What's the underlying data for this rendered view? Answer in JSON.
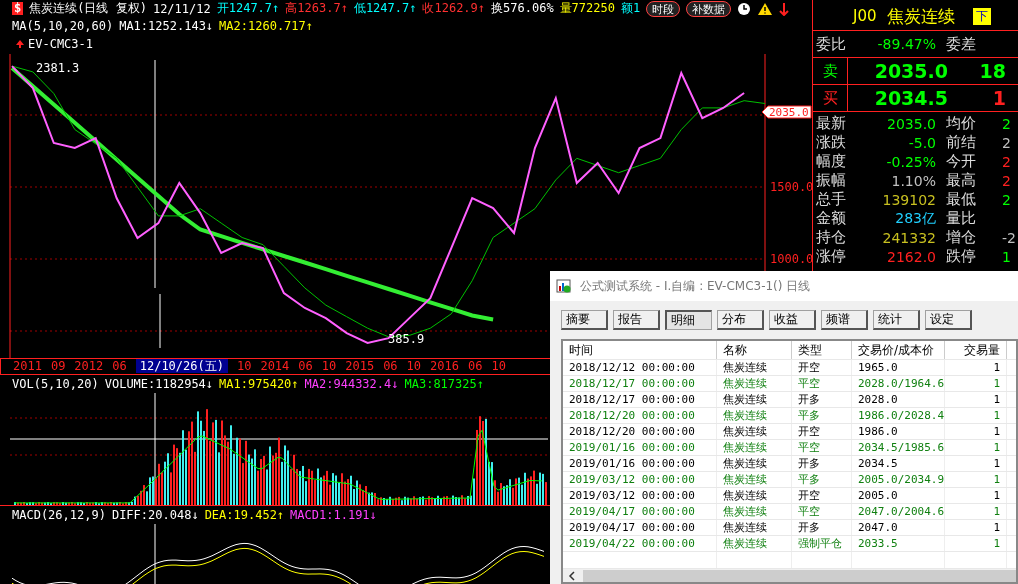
{
  "quote_header": {
    "symbol": "$",
    "items": [
      {
        "text": "焦炭连续(日线 复权)",
        "color": "#ffffff"
      },
      {
        "text": "12/11/12",
        "color": "#ffffff"
      },
      {
        "text": "开1247.7↑",
        "color": "#00ffff"
      },
      {
        "text": "高1263.7↑",
        "color": "#ff3030"
      },
      {
        "text": "低1247.7↑",
        "color": "#00ffff"
      },
      {
        "text": "收1262.9↑",
        "color": "#ff3030"
      },
      {
        "text": "换576.06%",
        "color": "#ffffff"
      },
      {
        "text": "量772250",
        "color": "#ffff00"
      },
      {
        "text": "额1",
        "color": "#00ffff"
      }
    ],
    "buttons": [
      "时段",
      "补数据"
    ]
  },
  "ma_line": {
    "label": "MA(5,10,20,60)",
    "items": [
      {
        "text": "MA1:1252.143↓",
        "color": "#ffffff"
      },
      {
        "text": "MA2:1260.717↑",
        "color": "#ffff00"
      }
    ]
  },
  "price_chart": {
    "high_label": "2381.3",
    "low_label": "385.9",
    "last_price": "2035.0",
    "chart_data": {
      "type": "line",
      "ylim": [
        313,
        2424
      ],
      "yticks": [
        {
          "value": 1000,
          "label": "1000.0"
        },
        {
          "value": 1500,
          "label": "1500.0"
        }
      ],
      "series": [
        {
          "color": "#ff60ff",
          "values": [
            2340,
            2187,
            1806,
            1771,
            1840,
            1424,
            1146,
            1250,
            1528,
            1319,
            1042,
            1111,
            1076,
            764,
            660,
            590,
            486,
            417,
            451,
            590,
            729,
            1076,
            1424,
            1354,
            1181,
            1771,
            2118,
            1528,
            1667,
            1458,
            1771,
            1840,
            2292,
            1979,
            2049,
            2153,
            null
          ]
        },
        {
          "color": "#00c000",
          "values": [
            2340,
            2300,
            2150,
            1900,
            1800,
            1700,
            1500,
            1300,
            1300,
            1350,
            1250,
            1150,
            1100,
            950,
            800,
            680,
            600,
            520,
            460,
            470,
            520,
            620,
            850,
            1150,
            1250,
            1350,
            1550,
            1700,
            1650,
            1600,
            1650,
            1700,
            1900,
            2050,
            2050,
            2100,
            2080
          ]
        },
        {
          "name": "EV-CMC3-1",
          "color": "#33ee33",
          "values": [
            2327,
            2200,
            2073,
            1946,
            1819,
            1692,
            1565,
            1438,
            1311,
            1205,
            1159,
            1113,
            1067,
            1021,
            976,
            930,
            884,
            838,
            792,
            746,
            700,
            654,
            608,
            580,
            null,
            null,
            null,
            null,
            null,
            null,
            null,
            null,
            null,
            null,
            null,
            null,
            null
          ]
        }
      ]
    }
  },
  "date_axis": [
    {
      "label": "2011",
      "selected": false
    },
    {
      "label": "09",
      "selected": false
    },
    {
      "label": "2012",
      "selected": false
    },
    {
      "label": "06",
      "selected": false
    },
    {
      "label": "12/10/26(五)",
      "selected": true
    },
    {
      "label": "10",
      "selected": false
    },
    {
      "label": "2014",
      "selected": false
    },
    {
      "label": "06",
      "selected": false
    },
    {
      "label": "10",
      "selected": false
    },
    {
      "label": "2015",
      "selected": false
    },
    {
      "label": "06",
      "selected": false
    },
    {
      "label": "10",
      "selected": false
    },
    {
      "label": "2016",
      "selected": false
    },
    {
      "label": "06",
      "selected": false
    },
    {
      "label": "10",
      "selected": false
    }
  ],
  "volume_panel": {
    "label": "VOL(5,10,20)",
    "items": [
      {
        "text": "VOLUME:1182954↓",
        "color": "#ffffff"
      },
      {
        "text": "MA1:975420↑",
        "color": "#ffff00"
      },
      {
        "text": "MA2:944332.4↓",
        "color": "#ff40ff"
      },
      {
        "text": "MA3:817325↑",
        "color": "#00ff00"
      }
    ]
  },
  "macd_panel": {
    "label": "MACD(26,12,9)",
    "items": [
      {
        "text": "DIFF:20.048↓",
        "color": "#ffffff"
      },
      {
        "text": "DEA:19.452↑",
        "color": "#ffff00"
      },
      {
        "text": "MACD1:1.191↓",
        "color": "#ff40ff"
      }
    ]
  },
  "quote_panel": {
    "code": "J00",
    "name": "焦炭连续",
    "badge": "下",
    "ratio": {
      "label": "委比",
      "value": "-89.47%",
      "color": "#00ff00",
      "label2": "委差"
    },
    "book": [
      {
        "kind": "sell",
        "label": "卖",
        "price": "2035.0",
        "volume": "18",
        "color": "#00ff00"
      },
      {
        "kind": "buy",
        "label": "买",
        "price": "2034.5",
        "volume": "1",
        "color": "#ff2020"
      }
    ],
    "rows": [
      {
        "left": {
          "label": "最新",
          "value": "2035.0",
          "color": "#00ff00"
        },
        "right": {
          "label": "均价",
          "value": "2",
          "color": "#00ff00"
        }
      },
      {
        "left": {
          "label": "涨跌",
          "value": "-5.0",
          "color": "#00ff00"
        },
        "right": {
          "label": "前结",
          "value": "2",
          "color": "#c0c0c0"
        }
      },
      {
        "left": {
          "label": "幅度",
          "value": "-0.25%",
          "color": "#00ff00"
        },
        "right": {
          "label": "今开",
          "value": "2",
          "color": "#ff2020"
        }
      },
      {
        "left": {
          "label": "振幅",
          "value": "1.10%",
          "color": "#c0c0c0"
        },
        "right": {
          "label": "最高",
          "value": "2",
          "color": "#ff2020"
        }
      },
      {
        "left": {
          "label": "总手",
          "value": "139102",
          "color": "#c8c020"
        },
        "right": {
          "label": "最低",
          "value": "2",
          "color": "#00ff00"
        }
      },
      {
        "left": {
          "label": "金额",
          "value": "283亿",
          "color": "#20d0ff"
        },
        "right": {
          "label": "量比"
        }
      },
      {
        "left": {
          "label": "持仓",
          "value": "241332",
          "color": "#c8c020"
        },
        "right": {
          "label": "增仓",
          "value": "-2",
          "color": "#c0c0c0"
        }
      },
      {
        "left": {
          "label": "涨停",
          "value": "2162.0",
          "color": "#ff2020"
        },
        "right": {
          "label": "跌停",
          "value": "1",
          "color": "#00ff00"
        }
      }
    ]
  },
  "dialog": {
    "title": "公式测试系统 - I.自编 : EV-CMC3-1() 日线",
    "tabs": [
      {
        "label": "摘要",
        "selected": false
      },
      {
        "label": "报告",
        "selected": false
      },
      {
        "label": "明细",
        "selected": true
      },
      {
        "label": "分布",
        "selected": false
      },
      {
        "label": "收益",
        "selected": false
      },
      {
        "label": "频谱",
        "selected": false
      },
      {
        "label": "统计",
        "selected": false
      },
      {
        "label": "设定",
        "selected": false
      }
    ],
    "table": {
      "columns": [
        "时间",
        "名称",
        "类型",
        "交易价/成本价",
        "交易量"
      ],
      "rows": [
        {
          "kind": "open",
          "cells": [
            "2018/12/12  00:00:00",
            "焦炭连续",
            "开空",
            "1965.0",
            "1"
          ]
        },
        {
          "kind": "close",
          "cells": [
            "2018/12/17  00:00:00",
            "焦炭连续",
            "平空",
            "2028.0/1964.6",
            "1"
          ]
        },
        {
          "kind": "open",
          "cells": [
            "2018/12/17  00:00:00",
            "焦炭连续",
            "开多",
            "2028.0",
            "1"
          ]
        },
        {
          "kind": "close",
          "cells": [
            "2018/12/20  00:00:00",
            "焦炭连续",
            "平多",
            "1986.0/2028.4",
            "1"
          ]
        },
        {
          "kind": "open",
          "cells": [
            "2018/12/20  00:00:00",
            "焦炭连续",
            "开空",
            "1986.0",
            "1"
          ]
        },
        {
          "kind": "close",
          "cells": [
            "2019/01/16  00:00:00",
            "焦炭连续",
            "平空",
            "2034.5/1985.6",
            "1"
          ]
        },
        {
          "kind": "open",
          "cells": [
            "2019/01/16  00:00:00",
            "焦炭连续",
            "开多",
            "2034.5",
            "1"
          ]
        },
        {
          "kind": "close",
          "cells": [
            "2019/03/12  00:00:00",
            "焦炭连续",
            "平多",
            "2005.0/2034.9",
            "1"
          ]
        },
        {
          "kind": "open",
          "cells": [
            "2019/03/12  00:00:00",
            "焦炭连续",
            "开空",
            "2005.0",
            "1"
          ]
        },
        {
          "kind": "close",
          "cells": [
            "2019/04/17  00:00:00",
            "焦炭连续",
            "平空",
            "2047.0/2004.6",
            "1"
          ]
        },
        {
          "kind": "open",
          "cells": [
            "2019/04/17  00:00:00",
            "焦炭连续",
            "开多",
            "2047.0",
            "1"
          ]
        },
        {
          "kind": "close",
          "cells": [
            "2019/04/22  00:00:00",
            "焦炭连续",
            "强制平仓",
            "2033.5",
            "1"
          ]
        }
      ]
    }
  }
}
